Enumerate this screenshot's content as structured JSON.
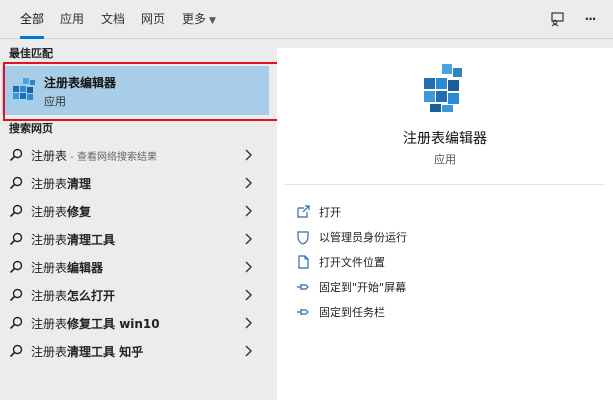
{
  "tabs": [
    {
      "label": "全部"
    },
    {
      "label": "应用"
    },
    {
      "label": "文档"
    },
    {
      "label": "网页"
    },
    {
      "label": "更多"
    }
  ],
  "toolbar": {
    "feedback_icon": "feedback-icon",
    "more_icon": "ellipsis-icon",
    "more_label": "···"
  },
  "left": {
    "best_match_title": "最佳匹配",
    "best_match": {
      "name": "注册表编辑器",
      "type": "应用",
      "icon": "regedit-icon"
    },
    "web_title": "搜索网页",
    "web_results": [
      {
        "query": "注册表",
        "suffix": "",
        "hint": " - 查看网络搜索结果"
      },
      {
        "query": "注册表",
        "suffix": "清理",
        "hint": ""
      },
      {
        "query": "注册表",
        "suffix": "修复",
        "hint": ""
      },
      {
        "query": "注册表",
        "suffix": "清理工具",
        "hint": ""
      },
      {
        "query": "注册表",
        "suffix": "编辑器",
        "hint": ""
      },
      {
        "query": "注册表",
        "suffix": "怎么打开",
        "hint": ""
      },
      {
        "query": "注册表",
        "suffix": "修复工具 win10",
        "hint": ""
      },
      {
        "query": "注册表",
        "suffix": "清理工具 知乎",
        "hint": ""
      }
    ]
  },
  "preview": {
    "name": "注册表编辑器",
    "type": "应用",
    "actions": [
      {
        "label": "打开",
        "icon": "open-icon"
      },
      {
        "label": "以管理员身份运行",
        "icon": "shield-icon"
      },
      {
        "label": "打开文件位置",
        "icon": "file-location-icon"
      },
      {
        "label": "固定到\"开始\"屏幕",
        "icon": "pin-icon"
      },
      {
        "label": "固定到任务栏",
        "icon": "pin-icon"
      }
    ]
  },
  "colors": {
    "accent": "#0078d7",
    "highlight": "#a8cde9",
    "annotation": "#e0141e"
  }
}
